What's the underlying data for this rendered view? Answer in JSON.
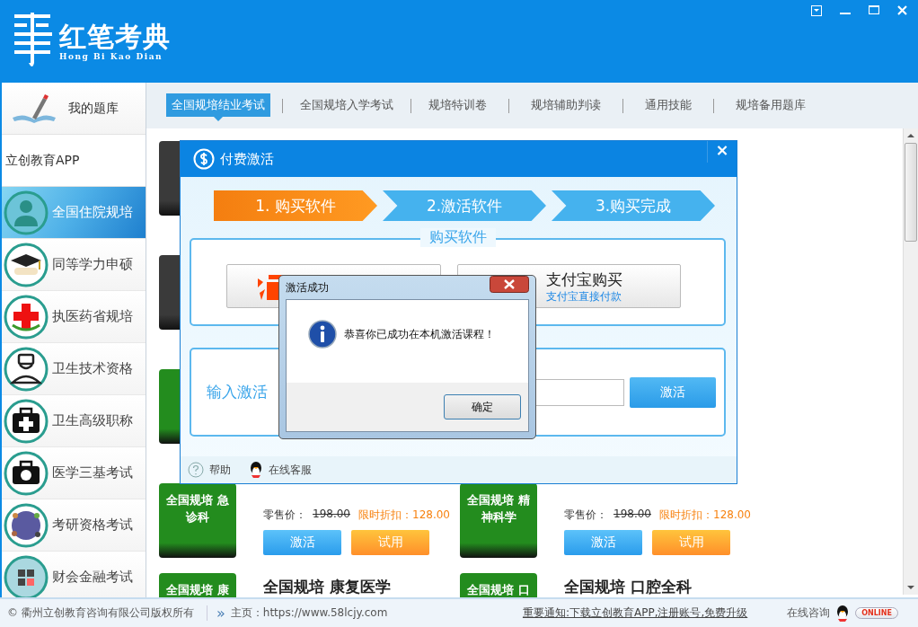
{
  "app": {
    "name": "红笔考典",
    "subtitle": "Hong Bi Kao Dian"
  },
  "sidebar": {
    "my_bank": "我的题库",
    "app_link": "立创教育APP",
    "items": [
      {
        "label": "全国住院规培",
        "selected": true
      },
      {
        "label": "同等学力申硕",
        "selected": false
      },
      {
        "label": "执医药省规培",
        "selected": false
      },
      {
        "label": "卫生技术资格",
        "selected": false
      },
      {
        "label": "卫生高级职称",
        "selected": false
      },
      {
        "label": "医学三基考试",
        "selected": false
      },
      {
        "label": "考研资格考试",
        "selected": false
      },
      {
        "label": "财会金融考试",
        "selected": false
      }
    ]
  },
  "tabs": [
    {
      "label": "全国规培结业考试",
      "selected": true
    },
    {
      "label": "全国规培入学考试",
      "selected": false
    },
    {
      "label": "规培特训卷",
      "selected": false
    },
    {
      "label": "规培辅助判读",
      "selected": false
    },
    {
      "label": "通用技能",
      "selected": false
    },
    {
      "label": "规培备用题库",
      "selected": false
    }
  ],
  "card_rows": [
    [
      {
        "color": "#3a3a3a"
      }
    ],
    [
      {
        "color": "#3a3a3a"
      }
    ],
    [
      {
        "color": "#238c1e"
      }
    ],
    [
      {
        "color": "#238c1e",
        "tile": "全国规培 急诊科",
        "retail_label": "零售价：",
        "retail_price": "198.00",
        "discount": "限时折扣：128.00",
        "activate": "激活",
        "trial": "试用"
      },
      {
        "color": "#238c1e",
        "tile": "全国规培 精神科学",
        "retail_label": "零售价：",
        "retail_price": "198.00",
        "discount": "限时折扣：128.00",
        "activate": "激活",
        "trial": "试用"
      }
    ],
    [
      {
        "color": "#238c1e",
        "tile": "全国规培 康",
        "title": "全国规培 康复医学"
      },
      {
        "color": "#238c1e",
        "tile": "全国规培 口",
        "title": "全国规培 口腔全科"
      }
    ]
  ],
  "status_bar": {
    "copyright": "© 衢州立创教育咨询有限公司版权所有",
    "separator": "»",
    "homepage": "主页：https://www.58lcjy.com",
    "notice": "重要通知:下载立创教育APP,注册账号,免费升级",
    "consult": "在线咨询",
    "online": "ONLINE"
  },
  "activation_dialog": {
    "title": "付费激活",
    "close": "×",
    "steps": [
      {
        "label": "1. 购买软件",
        "selected": true
      },
      {
        "label": "2.激活软件",
        "selected": false
      },
      {
        "label": "3.购买完成",
        "selected": false
      }
    ],
    "buy_legend": "购买软件",
    "alipay_title": "支付宝购买",
    "alipay_sub": "支付宝直接付款",
    "code_label": "输入激活",
    "activate_button": "激活",
    "help": "帮助",
    "service": "在线客服"
  },
  "message_box": {
    "title": "激活成功",
    "text": "恭喜你已成功在本机激活课程！",
    "ok": "确定"
  }
}
